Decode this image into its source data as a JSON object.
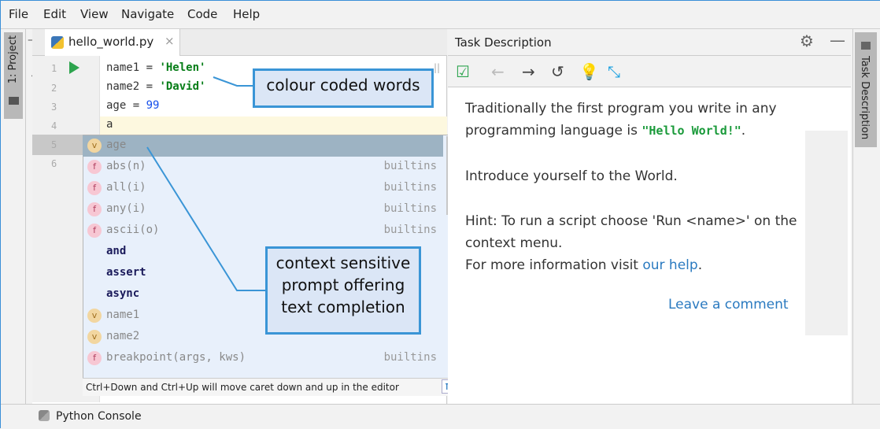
{
  "menu": [
    "File",
    "Edit",
    "View",
    "Navigate",
    "Code",
    "Help"
  ],
  "left_tool": {
    "label": "1: Project"
  },
  "editor": {
    "tab": "hello_world.py",
    "close": "×",
    "lines": [
      "1",
      "2",
      "3",
      "4",
      "5",
      "6"
    ],
    "code": {
      "l1_a": "name1 = ",
      "l1_b": "'Helen'",
      "l2_a": "name2 = ",
      "l2_b": "'David'",
      "l3_a": "age = ",
      "l3_b": "99",
      "l4": "a"
    }
  },
  "completion": {
    "items": [
      {
        "kind": "v",
        "name": "age",
        "type": ""
      },
      {
        "kind": "f",
        "name": "abs(n)",
        "type": "builtins"
      },
      {
        "kind": "f",
        "name": "all(i)",
        "type": "builtins"
      },
      {
        "kind": "f",
        "name": "any(i)",
        "type": "builtins"
      },
      {
        "kind": "f",
        "name": "ascii(o)",
        "type": "builtins"
      },
      {
        "kind": "",
        "name": "and",
        "type": ""
      },
      {
        "kind": "",
        "name": "assert",
        "type": ""
      },
      {
        "kind": "",
        "name": "async",
        "type": ""
      },
      {
        "kind": "v",
        "name": "name1",
        "type": ""
      },
      {
        "kind": "v",
        "name": "name2",
        "type": ""
      },
      {
        "kind": "f",
        "name": "breakpoint(args, kws)",
        "type": "builtins"
      }
    ],
    "footer": "Ctrl+Down and Ctrl+Up will move caret down and up in the editor",
    "pi": "π"
  },
  "callouts": {
    "c1": "colour coded words",
    "c2": "context sensitive prompt offering text completion"
  },
  "task": {
    "title": "Task Description",
    "p1a": "Traditionally the first program you write in any",
    "p1b": "programming language is ",
    "p1code": "\"Hello World!\"",
    "p1end": ".",
    "p2": "Introduce yourself to the World.",
    "p3a": "Hint: To run a script choose 'Run <name>' on the",
    "p3b": "context menu.",
    "p4a": "For more information visit ",
    "p4link": "our help",
    "p4end": ".",
    "comment": "Leave a comment"
  },
  "right_tool": {
    "label": "Task Description"
  },
  "bottom": {
    "console": "Python Console"
  }
}
